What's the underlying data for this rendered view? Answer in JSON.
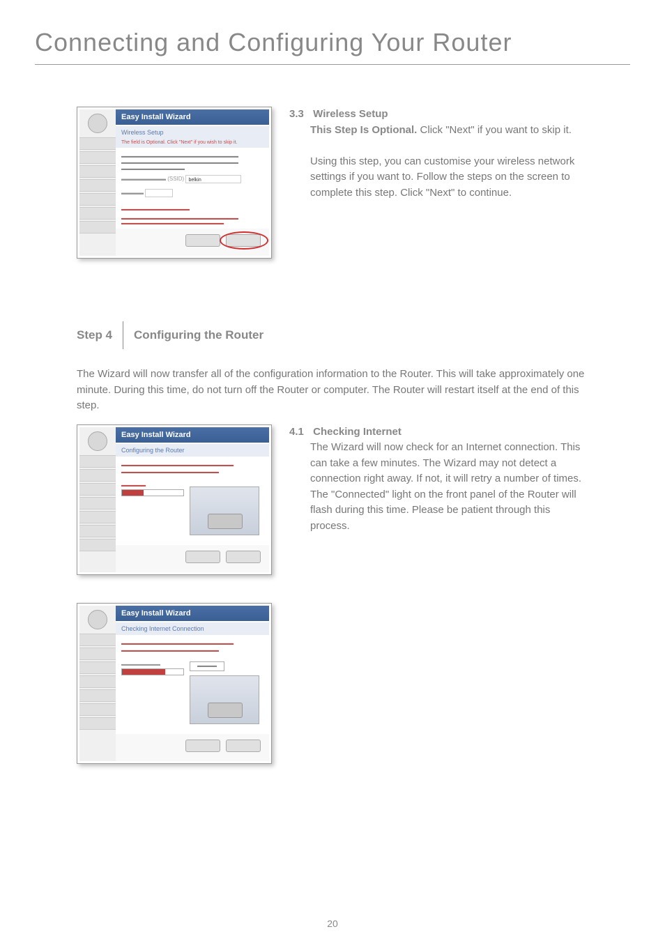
{
  "page_title": "Connecting and Configuring Your Router",
  "page_number": "20",
  "screenshot1": {
    "wizard_title": "Easy Install Wizard",
    "subtitle": "Wireless Setup",
    "warning": "The field is Optional. Click \"Next\" if you wish to skip it."
  },
  "section_3_3": {
    "number": "3.3",
    "title": "Wireless Setup",
    "lead": "This Step Is Optional.",
    "lead_rest": " Click \"Next\" if you want to skip it.",
    "body": "Using this step, you can customise your wireless network settings if you want to. Follow the steps on the screen to complete this step. Click \"Next\" to continue."
  },
  "step4": {
    "label": "Step 4",
    "title": "Configuring the Router",
    "intro": "The Wizard will now transfer all of the configuration information to the Router. This will take approximately one minute. During this time, do not turn off the Router or computer. The Router will restart itself at the end of this step."
  },
  "screenshot2": {
    "wizard_title": "Easy Install Wizard",
    "subtitle": "Configuring the Router"
  },
  "section_4_1": {
    "number": "4.1",
    "title": "Checking Internet",
    "body": "The Wizard will now check for an Internet connection. This can take a few minutes. The Wizard may not detect a connection right away. If not, it will retry a number of times. The \"Connected\" light on the front panel of the Router will flash during this time. Please be patient through this process."
  },
  "screenshot3": {
    "wizard_title": "Easy Install Wizard",
    "subtitle": "Checking Internet Connection"
  }
}
